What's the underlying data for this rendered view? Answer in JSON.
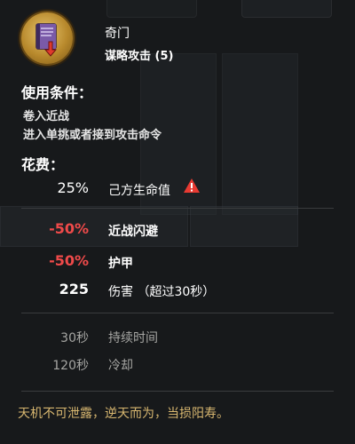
{
  "skill": {
    "name": "奇门",
    "subtitle": "谋略攻击 (5)",
    "icon": "strategy-book-icon"
  },
  "conditions": {
    "header": "使用条件：",
    "lines": [
      "卷入近战",
      "进入单挑或者接到攻击命令"
    ]
  },
  "cost": {
    "header": "花费：",
    "value": "25%",
    "label": "己方生命值",
    "warning_icon": "warning-icon",
    "warning_color": "#e83a32"
  },
  "effects": [
    {
      "value": "-50%",
      "label": "近战闪避",
      "color": "#ef4a4a"
    },
    {
      "value": "-50%",
      "label": "护甲",
      "color": "#ef4a4a"
    },
    {
      "value": "225",
      "label": "伤害 （超过30秒）",
      "color": "#ffffff"
    }
  ],
  "timing": [
    {
      "value": "30秒",
      "label": "持续时间"
    },
    {
      "value": "120秒",
      "label": "冷却"
    }
  ],
  "flavor_text": "天机不可泄露，逆天而为，当损阳寿。",
  "colors": {
    "background": "#17191b",
    "negative": "#ef4a4a",
    "flavor": "#d8b770",
    "muted": "#a6a6a3"
  }
}
